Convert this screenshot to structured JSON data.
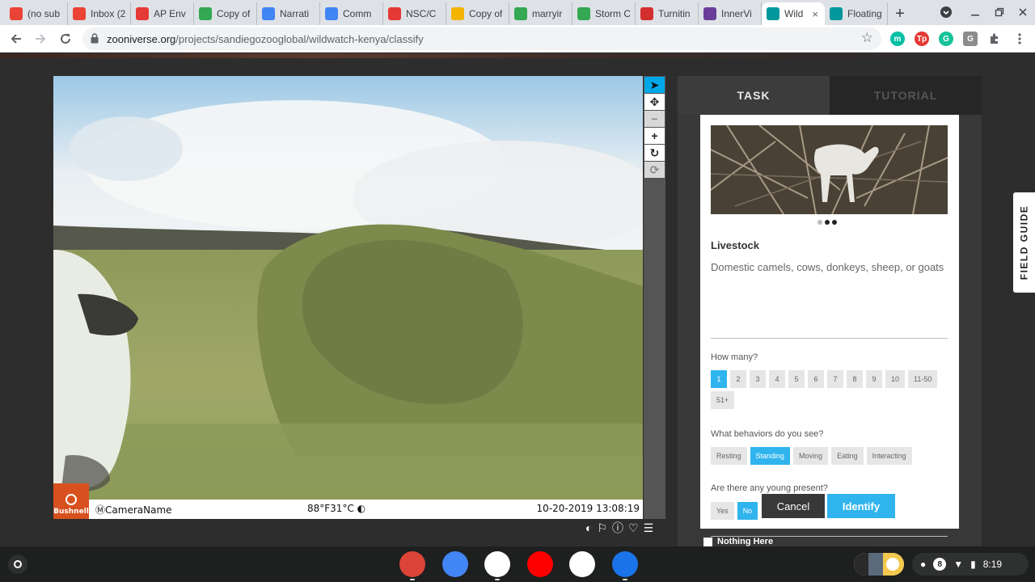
{
  "browser": {
    "tabs": [
      {
        "title": "(no sub",
        "favicon": "gmail-icon",
        "color": "#ea4335"
      },
      {
        "title": "Inbox (2",
        "favicon": "gmail-icon",
        "color": "#ea4335"
      },
      {
        "title": "AP Env",
        "favicon": "circle-icon",
        "color": "#e53935"
      },
      {
        "title": "Copy of",
        "favicon": "drive-icon",
        "color": "#34a853"
      },
      {
        "title": "Narrati",
        "favicon": "docs-icon",
        "color": "#4285f4"
      },
      {
        "title": "Comm",
        "favicon": "docs-icon",
        "color": "#4285f4"
      },
      {
        "title": "NSC/C",
        "favicon": "circle-icon",
        "color": "#e53935"
      },
      {
        "title": "Copy of",
        "favicon": "slides-icon",
        "color": "#f4b400"
      },
      {
        "title": "marryir",
        "favicon": "drive-icon",
        "color": "#34a853"
      },
      {
        "title": "Storm C",
        "favicon": "drive-icon",
        "color": "#34a853"
      },
      {
        "title": "Turnitin",
        "favicon": "turnitin-icon",
        "color": "#d32f2f"
      },
      {
        "title": "InnerVi",
        "favicon": "innerview-icon",
        "color": "#6a3d9a"
      },
      {
        "title": "Wild",
        "favicon": "zooniverse-icon",
        "color": "#00979d",
        "active": true
      },
      {
        "title": "Floating",
        "favicon": "zooniverse-icon",
        "color": "#00979d"
      }
    ],
    "new_tab": "+",
    "close_glyph": "×",
    "url_host": "zooniverse.org",
    "url_path": "/projects/sandiegozooglobal/wildwatch-kenya/classify",
    "extensions": [
      {
        "label": "m",
        "color": "#00bfa5"
      },
      {
        "label": "Tp",
        "color": "#e53935"
      },
      {
        "label": "G",
        "color": "#15c39a"
      },
      {
        "label": "G",
        "color": "#8c8c8c"
      }
    ]
  },
  "camera": {
    "brand": "Bushnell",
    "camera_name": "CameraName",
    "temperature": "88°F31°C",
    "datetime": "10-20-2019 13:08:19"
  },
  "tools": [
    {
      "name": "pointer-tool",
      "glyph": "➤"
    },
    {
      "name": "pan-tool",
      "glyph": "✥"
    },
    {
      "name": "zoom-out-tool",
      "glyph": "−"
    },
    {
      "name": "zoom-in-tool",
      "glyph": "+"
    },
    {
      "name": "rotate-tool",
      "glyph": "↻"
    },
    {
      "name": "reset-tool",
      "glyph": "⟳"
    }
  ],
  "panel": {
    "tab_task": "TASK",
    "tab_tutorial": "TUTORIAL",
    "species_name": "Livestock",
    "species_desc": "Domestic camels, cows, donkeys, sheep, or goats",
    "q_count": "How many?",
    "count_options": [
      "1",
      "2",
      "3",
      "4",
      "5",
      "6",
      "7",
      "8",
      "9",
      "10",
      "11-50",
      "51+"
    ],
    "count_selected": "1",
    "q_behavior": "What behaviors do you see?",
    "behavior_options": [
      "Resting",
      "Standing",
      "Moving",
      "Eating",
      "Interacting"
    ],
    "behavior_selected": "Standing",
    "q_young": "Are there any young present?",
    "young_options": [
      "Yes",
      "No"
    ],
    "young_selected": "No",
    "cancel": "Cancel",
    "identify": "Identify",
    "nothing_here": "Nothing Here",
    "field_guide": "FIELD GUIDE"
  },
  "shelf": {
    "apps": [
      {
        "name": "chrome-app",
        "color": "#db4437"
      },
      {
        "name": "docs-app",
        "color": "#4285f4"
      },
      {
        "name": "gmail-app",
        "color": "#ffffff"
      },
      {
        "name": "youtube-app",
        "color": "#ff0000"
      },
      {
        "name": "play-store-app",
        "color": "#ffffff"
      },
      {
        "name": "files-app",
        "color": "#1a73e8"
      }
    ],
    "notifications": "8",
    "time": "8:19"
  }
}
